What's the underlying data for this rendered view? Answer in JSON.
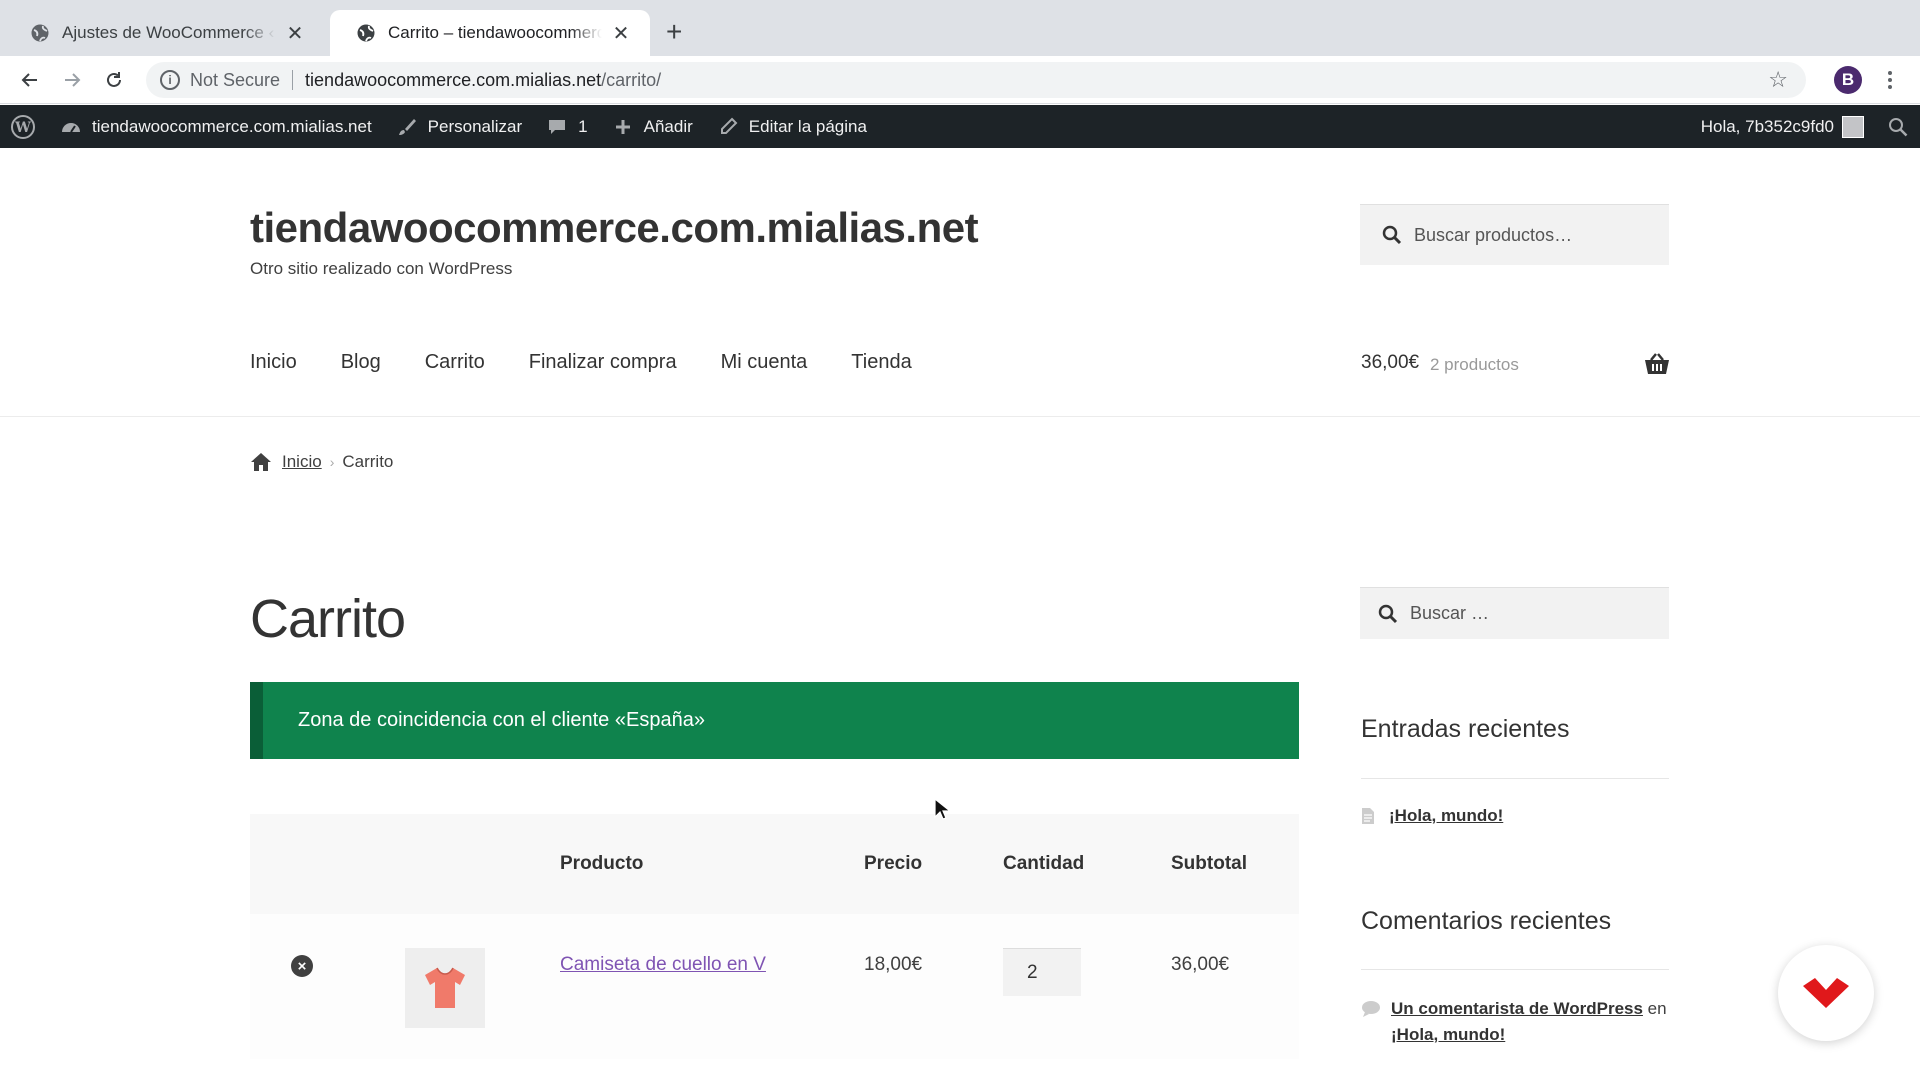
{
  "browser": {
    "tabs": [
      {
        "title": "Ajustes de WooCommerce ‹ tiendawoocommerce.com.mialias.net",
        "close": "✕"
      },
      {
        "title": "Carrito – tiendawoocommerce.com.mialias.net",
        "close": "✕"
      }
    ],
    "new_tab": "+",
    "address": {
      "security_label": "Not Secure",
      "host": "tiendawoocommerce.com.mialias.net",
      "path": "/carrito/"
    },
    "profile_initial": "B"
  },
  "admin_bar": {
    "site_name": "tiendawoocommerce.com.mialias.net",
    "customize": "Personalizar",
    "comments_count": "1",
    "add_new": "Añadir",
    "edit_page": "Editar la página",
    "greeting": "Hola, 7b352c9fd0"
  },
  "header": {
    "site_title": "tiendawoocommerce.com.mialias.net",
    "tagline": "Otro sitio realizado con WordPress",
    "search_placeholder": "Buscar productos…",
    "nav": [
      "Inicio",
      "Blog",
      "Carrito",
      "Finalizar compra",
      "Mi cuenta",
      "Tienda"
    ],
    "cart_total": "36,00€",
    "cart_count": "2 productos"
  },
  "breadcrumb": {
    "home": "Inicio",
    "separator": "›",
    "current": "Carrito"
  },
  "content": {
    "title": "Carrito",
    "notice": "Zona de coincidencia con el cliente «España»",
    "table": {
      "headers": {
        "product": "Producto",
        "price": "Precio",
        "quantity": "Cantidad",
        "subtotal": "Subtotal"
      },
      "rows": [
        {
          "remove": "×",
          "product": "Camiseta de cuello en V",
          "price": "18,00€",
          "quantity": "2",
          "subtotal": "36,00€"
        }
      ]
    }
  },
  "sidebar": {
    "search_placeholder": "Buscar …",
    "recent_posts_title": "Entradas recientes",
    "recent_posts": [
      "¡Hola, mundo!"
    ],
    "recent_comments_title": "Comentarios recientes",
    "recent_comments": [
      {
        "author": "Un comentarista de WordPress",
        "connector": "en",
        "post": "¡Hola, mundo!"
      }
    ]
  },
  "colors": {
    "notice_bg": "#0f834d",
    "link_purple": "#7f54b3",
    "admin_bar": "#1d2327",
    "badge_red": "#e0181b"
  }
}
